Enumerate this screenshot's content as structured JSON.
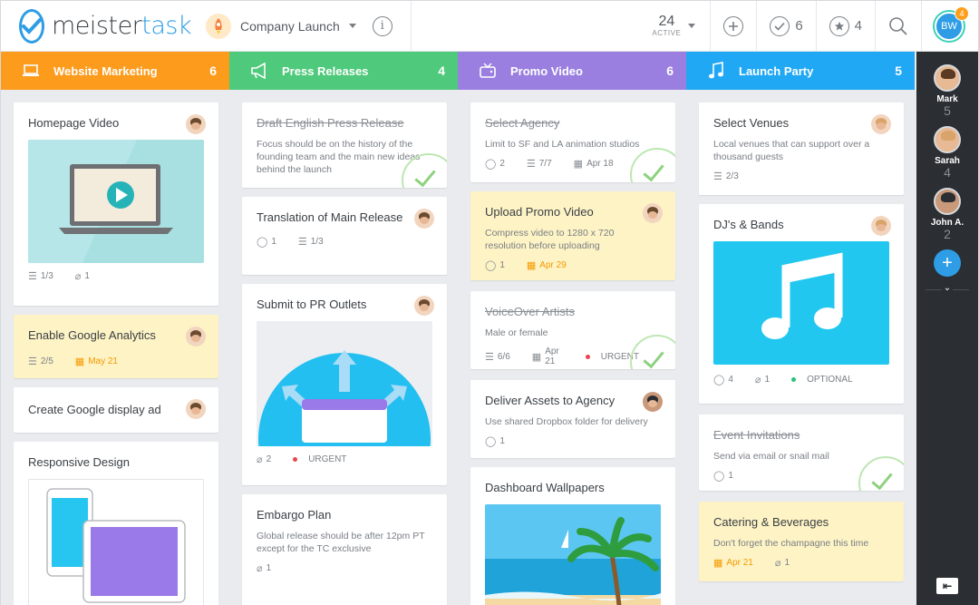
{
  "header": {
    "logo_main": "meister",
    "logo_accent": "task",
    "project_name": "Company Launch",
    "active_count": "24",
    "active_label": "ACTIVE",
    "completed_count": "6",
    "starred_count": "4",
    "user_initials": "BW",
    "notification_count": "4"
  },
  "colors": {
    "website_marketing": "#fd9b1c",
    "press_releases": "#4fc97b",
    "promo_video": "#9a7fe0",
    "launch_party": "#20a8f5",
    "brand": "#2e9de6",
    "highlight_card": "#fdf3c5"
  },
  "columns": [
    {
      "title": "Website Marketing",
      "icon": "laptop-icon",
      "count": "6",
      "cards": [
        {
          "title": "Homepage Video",
          "checklist": "1/3",
          "attachments": "1"
        },
        {
          "title": "Enable Google Analytics",
          "checklist": "2/5",
          "due": "May 21"
        },
        {
          "title": "Create Google display ad"
        },
        {
          "title": "Responsive Design"
        }
      ]
    },
    {
      "title": "Press Releases",
      "icon": "megaphone-icon",
      "count": "4",
      "cards": [
        {
          "title": "Draft English Press Release",
          "note": "Focus should be on the history of the founding team and the main new ideas behind the launch"
        },
        {
          "title": "Translation of Main Release",
          "comments": "1",
          "checklist": "1/3"
        },
        {
          "title": "Submit to PR Outlets",
          "attachments": "2",
          "tag": "URGENT"
        },
        {
          "title": "Embargo Plan",
          "note": "Global release should be after 12pm PT except for the TC exclusive",
          "attachments": "1"
        }
      ]
    },
    {
      "title": "Promo Video",
      "icon": "tv-icon",
      "count": "6",
      "cards": [
        {
          "title": "Select Agency",
          "note": "Limit to SF and LA animation studios",
          "comments": "2",
          "checklist": "7/7",
          "due": "Apr 18"
        },
        {
          "title": "Upload Promo Video",
          "note": "Compress video to 1280 x 720 resolution before uploading",
          "comments": "1",
          "due": "Apr 29"
        },
        {
          "title": "VoiceOver Artists",
          "note": "Male or female",
          "checklist": "6/6",
          "due": "Apr 21",
          "tag": "URGENT"
        },
        {
          "title": "Deliver Assets to Agency",
          "note": "Use shared Dropbox folder for delivery",
          "comments": "1"
        },
        {
          "title": "Dashboard Wallpapers"
        }
      ]
    },
    {
      "title": "Launch Party",
      "icon": "music-note-icon",
      "count": "5",
      "cards": [
        {
          "title": "Select Venues",
          "note": "Local venues that can support over a thousand guests",
          "checklist": "2/3"
        },
        {
          "title": "DJ's & Bands",
          "comments": "4",
          "attachments": "1",
          "tag": "OPTIONAL"
        },
        {
          "title": "Event Invitations",
          "note": "Send via email or snail mail",
          "comments": "1"
        },
        {
          "title": "Catering & Beverages",
          "note": "Don't forget the champagne this time",
          "due": "Apr 21",
          "attachments": "1"
        }
      ]
    }
  ],
  "team": [
    {
      "name": "Mark",
      "count": "5"
    },
    {
      "name": "Sarah",
      "count": "4"
    },
    {
      "name": "John A.",
      "count": "2"
    }
  ]
}
